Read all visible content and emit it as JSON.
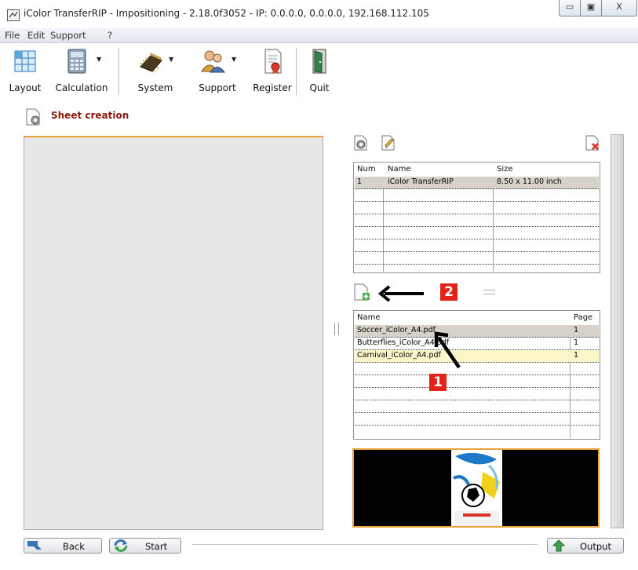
{
  "window": {
    "title": "iColor TransferRIP - Impositioning - 2.18.0f3052 - IP: 0.0.0.0, 0.0.0.0, 192.168.112.105",
    "min_glyph": "▭",
    "max_glyph": "▣",
    "close_glyph": "X"
  },
  "menu": [
    "File",
    "Edit",
    "Support",
    "?"
  ],
  "toolbar": {
    "layout": "Layout",
    "calculation": "Calculation",
    "system": "System",
    "support": "Support",
    "register": "Register",
    "quit": "Quit",
    "dropdown_glyph": "▼"
  },
  "section": {
    "title": "Sheet creation"
  },
  "sheets_table": {
    "headers": [
      "Num",
      "Name",
      "Size"
    ],
    "rows": [
      {
        "num": "1",
        "name": "iColor TransferRIP",
        "size": "8.50 x 11.00 inch"
      }
    ]
  },
  "files_table": {
    "headers": [
      "Name",
      "Page"
    ],
    "rows": [
      {
        "name": "Soccer_iColor_A4.pdf",
        "page": "1"
      },
      {
        "name": "Butterflies_iColor_A4.pdf",
        "page": "1"
      },
      {
        "name": "Carnival_iColor_A4.pdf",
        "page": "1"
      }
    ]
  },
  "annotations": {
    "badge1": "1",
    "badge2": "2"
  },
  "buttons": {
    "back": "Back",
    "start": "Start",
    "output": "Output"
  },
  "colors": {
    "accent_orange": "#e8a33a",
    "title_red": "#8b1a0e",
    "badge_red": "#e2231a",
    "row_selected": "#d6d2c9",
    "row_highlight": "#fbf6c8"
  }
}
